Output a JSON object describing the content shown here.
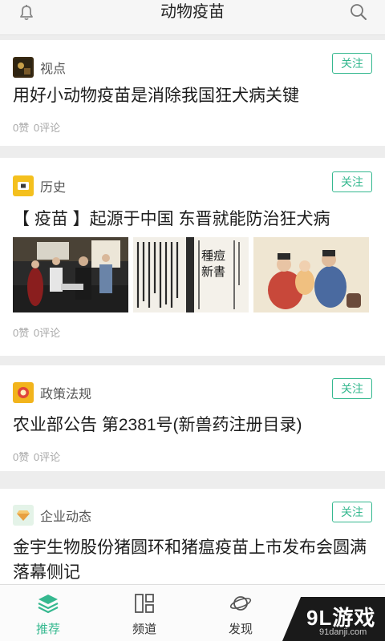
{
  "header": {
    "title": "动物疫苗",
    "bell_icon": "bell-icon",
    "search_icon": "search-icon"
  },
  "cards": [
    {
      "channel": "视点",
      "follow": "关注",
      "title": "用好小动物疫苗是消除我国狂犬病关键",
      "likes": "0赞",
      "comments": "0评论"
    },
    {
      "channel": "历史",
      "follow": "关注",
      "title": "【 疫苗 】起源于中国 东晋就能防治狂犬病",
      "likes": "0赞",
      "comments": "0评论",
      "images": [
        {
          "name": "museum-scene-image"
        },
        {
          "name": "ancient-book-image",
          "text_right": "種痘新書"
        },
        {
          "name": "child-inoculation-painting"
        }
      ]
    },
    {
      "channel": "政策法规",
      "follow": "关注",
      "title": "农业部公告 第2381号(新兽药注册目录)",
      "likes": "0赞",
      "comments": "0评论"
    },
    {
      "channel": "企业动态",
      "follow": "关注",
      "title": "金宇生物股份猪圆环和猪瘟疫苗上市发布会圆满落幕侧记"
    }
  ],
  "tabs": [
    {
      "label": "推荐",
      "icon": "layers-icon",
      "active": true
    },
    {
      "label": "频道",
      "icon": "grid-icon"
    },
    {
      "label": "发现",
      "icon": "planet-icon"
    }
  ],
  "watermark": {
    "main": "9L游戏",
    "sub": "91danji.com"
  },
  "colors": {
    "accent": "#35b88f",
    "meta": "#a8a8a8",
    "history_icon": "#f4c01e",
    "policy_icon": "#f2b41c",
    "company_icon": "#e4f3e8"
  }
}
